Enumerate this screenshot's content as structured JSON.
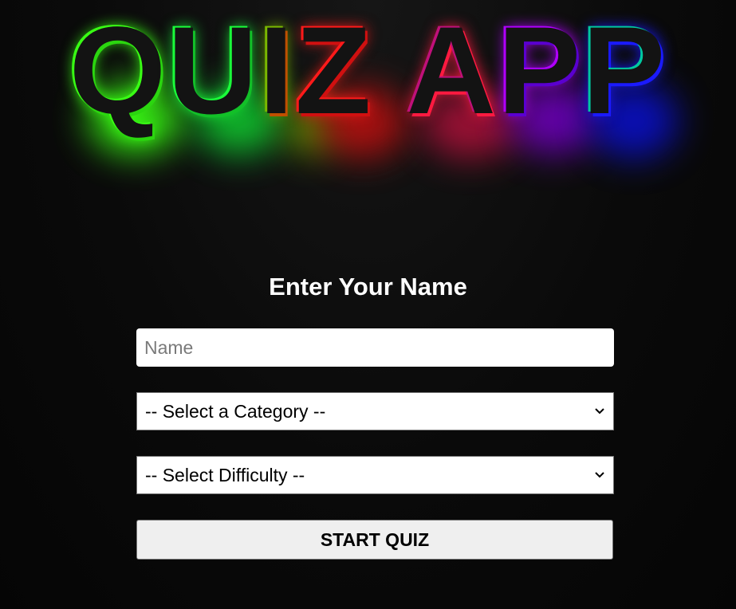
{
  "app": {
    "title_letters": [
      "Q",
      "U",
      "I",
      "Z",
      " ",
      "A",
      "P",
      "P"
    ],
    "title_glow_colors": [
      "#39ff14",
      "#1aff3a",
      "#7ab800",
      "#ff1a1a",
      "#ff1a40",
      "#b000ff",
      "#1a1aff",
      "#00c8a0"
    ]
  },
  "form": {
    "heading": "Enter Your Name",
    "name_input": {
      "value": "",
      "placeholder": "Name"
    },
    "category_select": {
      "selected": "-- Select a Category --"
    },
    "difficulty_select": {
      "selected": "-- Select Difficulty --"
    },
    "start_button_label": "START QUIZ"
  },
  "icons": {
    "select_chevron": "chevron-down-icon"
  }
}
